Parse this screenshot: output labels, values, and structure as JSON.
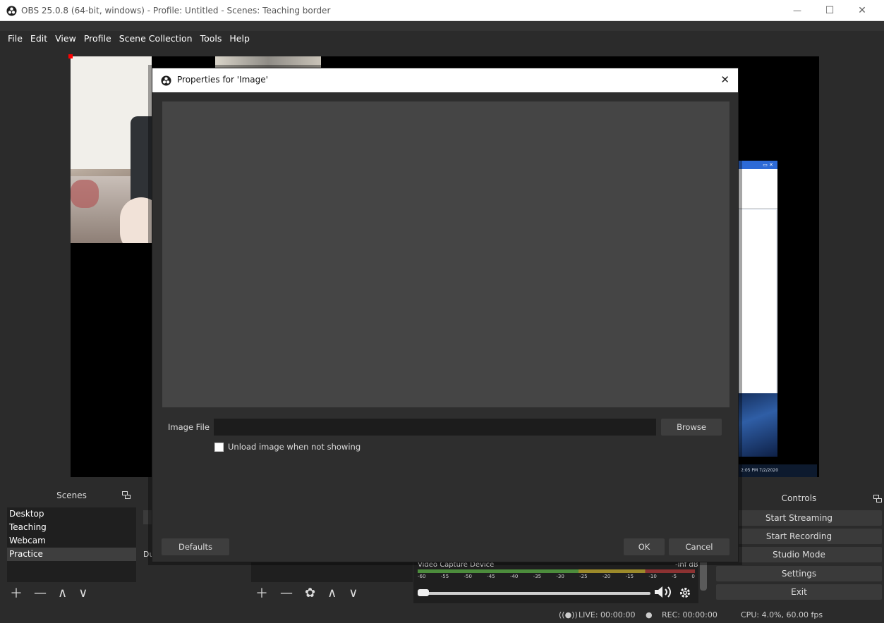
{
  "window": {
    "title": "OBS 25.0.8 (64-bit, windows) - Profile: Untitled - Scenes: Teaching border",
    "minimize": "—",
    "maximize": "☐",
    "close": "✕"
  },
  "menu": {
    "items": [
      "File",
      "Edit",
      "View",
      "Profile",
      "Scene Collection",
      "Tools",
      "Help"
    ]
  },
  "preview": {
    "desktop_taskbar_text": "2:05 PM 7/2/2020"
  },
  "scenes": {
    "header": "Scenes",
    "items": [
      "Desktop",
      "Teaching",
      "Webcam",
      "Practice"
    ],
    "selected": "Practice"
  },
  "sources": {
    "partial_label": "Du"
  },
  "mixer": {
    "device_name": "Video Capture Device",
    "db_value": "-inf dB",
    "ticks": [
      "-60",
      "-55",
      "-50",
      "-45",
      "-40",
      "-35",
      "-30",
      "-25",
      "-20",
      "-15",
      "-10",
      "-5",
      "0"
    ]
  },
  "controls": {
    "header": "Controls",
    "buttons": [
      "Start Streaming",
      "Start Recording",
      "Studio Mode",
      "Settings",
      "Exit"
    ]
  },
  "status": {
    "live": "LIVE: 00:00:00",
    "rec": "REC: 00:00:00",
    "cpu": "CPU: 4.0%, 60.00 fps"
  },
  "dialog": {
    "title": "Properties for 'Image'",
    "close": "✕",
    "image_file_label": "Image File",
    "image_file_value": "",
    "browse_label": "Browse",
    "unload_label": "Unload image when not showing",
    "unload_checked": false,
    "defaults_label": "Defaults",
    "ok_label": "OK",
    "cancel_label": "Cancel"
  },
  "colors": {
    "background": "#2b2b2b",
    "list_background": "#1f1f1f",
    "button": "#3a3a3a",
    "selection_handle": "#ff0000"
  }
}
